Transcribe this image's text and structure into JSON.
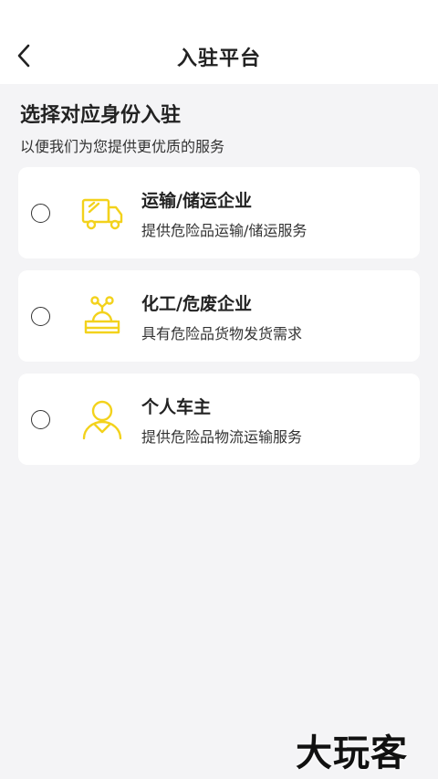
{
  "header": {
    "title": "入驻平台",
    "back_icon": "chevron-left-icon"
  },
  "intro": {
    "title": "选择对应身份入驻",
    "subtitle": "以便我们为您提供更优质的服务"
  },
  "options": [
    {
      "title": "运输/储运企业",
      "desc": "提供危险品运输/储运服务",
      "icon": "truck-icon",
      "selected": false
    },
    {
      "title": "化工/危废企业",
      "desc": "具有危险品货物发货需求",
      "icon": "chemical-icon",
      "selected": false
    },
    {
      "title": "个人车主",
      "desc": "提供危险品物流运输服务",
      "icon": "person-icon",
      "selected": false
    }
  ],
  "watermark": "大玩客",
  "colors": {
    "accent": "#f3d21c",
    "background": "#f4f4f6",
    "card": "#ffffff"
  }
}
